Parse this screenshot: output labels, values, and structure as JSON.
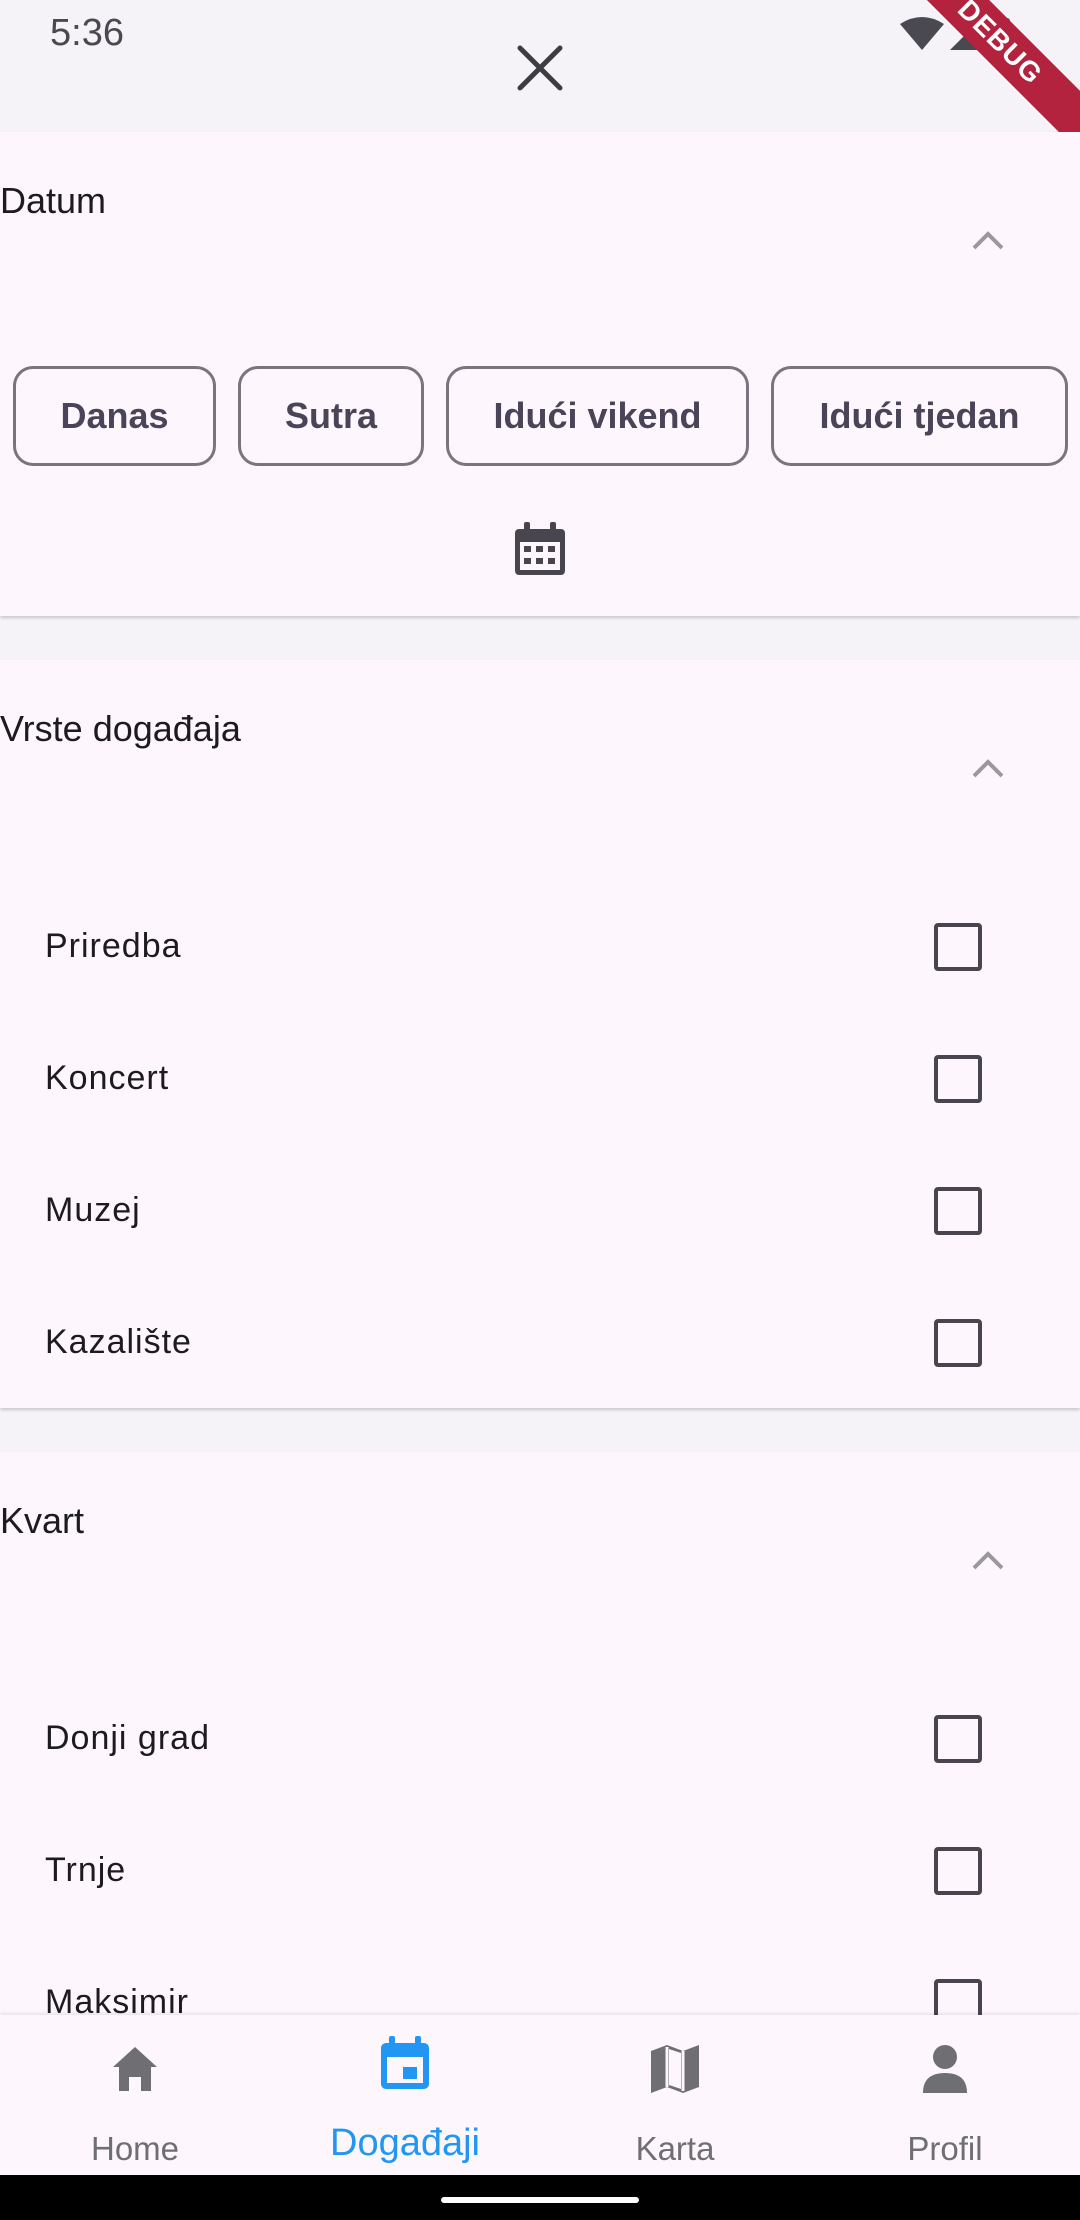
{
  "status_bar": {
    "time": "5:36",
    "debug_label": "DEBUG"
  },
  "date_section": {
    "title": "Datum",
    "chips": [
      "Danas",
      "Sutra",
      "Idući vikend",
      "Idući tjedan"
    ]
  },
  "event_types_section": {
    "title": "Vrste događaja",
    "items": [
      "Priredba",
      "Koncert",
      "Muzej",
      "Kazalište"
    ]
  },
  "district_section": {
    "title": "Kvart",
    "items": [
      "Donji grad",
      "Trnje",
      "Maksimir"
    ]
  },
  "bottom_nav": {
    "items": [
      {
        "label": "Home",
        "icon": "home-icon"
      },
      {
        "label": "Događaji",
        "icon": "calendar-icon"
      },
      {
        "label": "Karta",
        "icon": "map-icon"
      },
      {
        "label": "Profil",
        "icon": "person-icon"
      }
    ],
    "active_index": 1
  },
  "colors": {
    "accent": "#2196f3",
    "surface": "#fdf7fd",
    "background": "#f5f3f7",
    "debug": "#b4233e"
  }
}
